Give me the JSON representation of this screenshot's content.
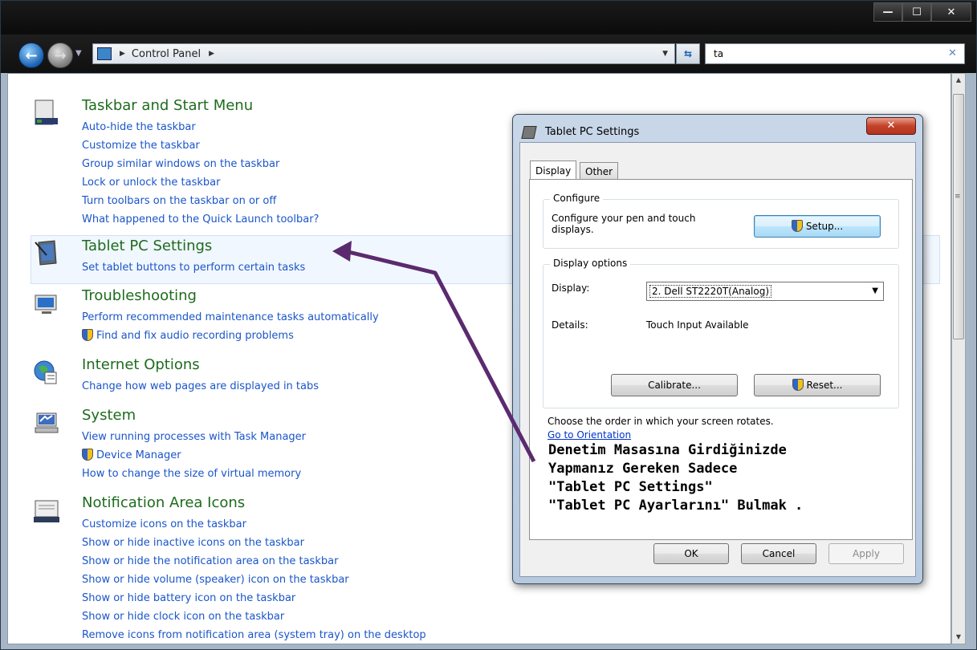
{
  "window": {
    "buttons": {
      "minimize": "—",
      "maximize": "☐",
      "close": "✕"
    }
  },
  "navbar": {
    "breadcrumb": "Control Panel",
    "search_value": "ta"
  },
  "groups": [
    {
      "title": "Taskbar and Start Menu",
      "icon": "taskbar-icon",
      "links": [
        "Auto-hide the taskbar",
        "Customize the taskbar",
        "Group similar windows on the taskbar",
        "Lock or unlock the taskbar",
        "Turn toolbars on the taskbar on or off",
        "What happened to the Quick Launch toolbar?"
      ]
    },
    {
      "title": "Tablet PC Settings",
      "icon": "tablet-pc-icon",
      "links": [
        "Set tablet buttons to perform certain tasks"
      ]
    },
    {
      "title": "Troubleshooting",
      "icon": "troubleshooting-icon",
      "links": [
        "Perform recommended maintenance tasks automatically",
        "Find and fix audio recording problems"
      ]
    },
    {
      "title": "Internet Options",
      "icon": "internet-options-icon",
      "links": [
        "Change how web pages are displayed in tabs"
      ]
    },
    {
      "title": "System",
      "icon": "system-icon",
      "links": [
        "View running processes with Task Manager",
        "Device Manager",
        "How to change the size of virtual memory"
      ]
    },
    {
      "title": "Notification Area Icons",
      "icon": "notification-area-icon",
      "links": [
        "Customize icons on the taskbar",
        "Show or hide inactive icons on the taskbar",
        "Show or hide the notification area on the taskbar",
        "Show or hide volume (speaker) icon on the taskbar",
        "Show or hide battery icon on the taskbar",
        "Show or hide clock icon on the taskbar",
        "Remove icons from notification area (system tray) on the desktop"
      ]
    }
  ],
  "dialog": {
    "title": "Tablet PC Settings",
    "close": "✕",
    "tabs": [
      "Display",
      "Other"
    ],
    "configure": {
      "legend": "Configure",
      "text_line1": "Configure your pen and touch",
      "text_line2": "displays.",
      "setup_button": "Setup..."
    },
    "display_options": {
      "legend": "Display options",
      "display_label": "Display:",
      "display_value": "2. Dell ST2220T(Analog)",
      "details_label": "Details:",
      "details_value": "Touch Input Available",
      "calibrate_button": "Calibrate...",
      "reset_button": "Reset..."
    },
    "orientation_text": "Choose the order in which your screen rotates.",
    "orientation_link": "Go to Orientation",
    "note": [
      "Denetim Masasına Girdiğinizde",
      "Yapmanız Gereken Sadece",
      "\"Tablet PC Settings\"",
      "\"Tablet PC Ayarlarını\" Bulmak ."
    ],
    "ok_button": "OK",
    "cancel_button": "Cancel",
    "apply_button": "Apply"
  },
  "colors": {
    "group_title": "#1e6b1e",
    "link": "#1a55c9",
    "arrow": "#5b2a6e"
  }
}
